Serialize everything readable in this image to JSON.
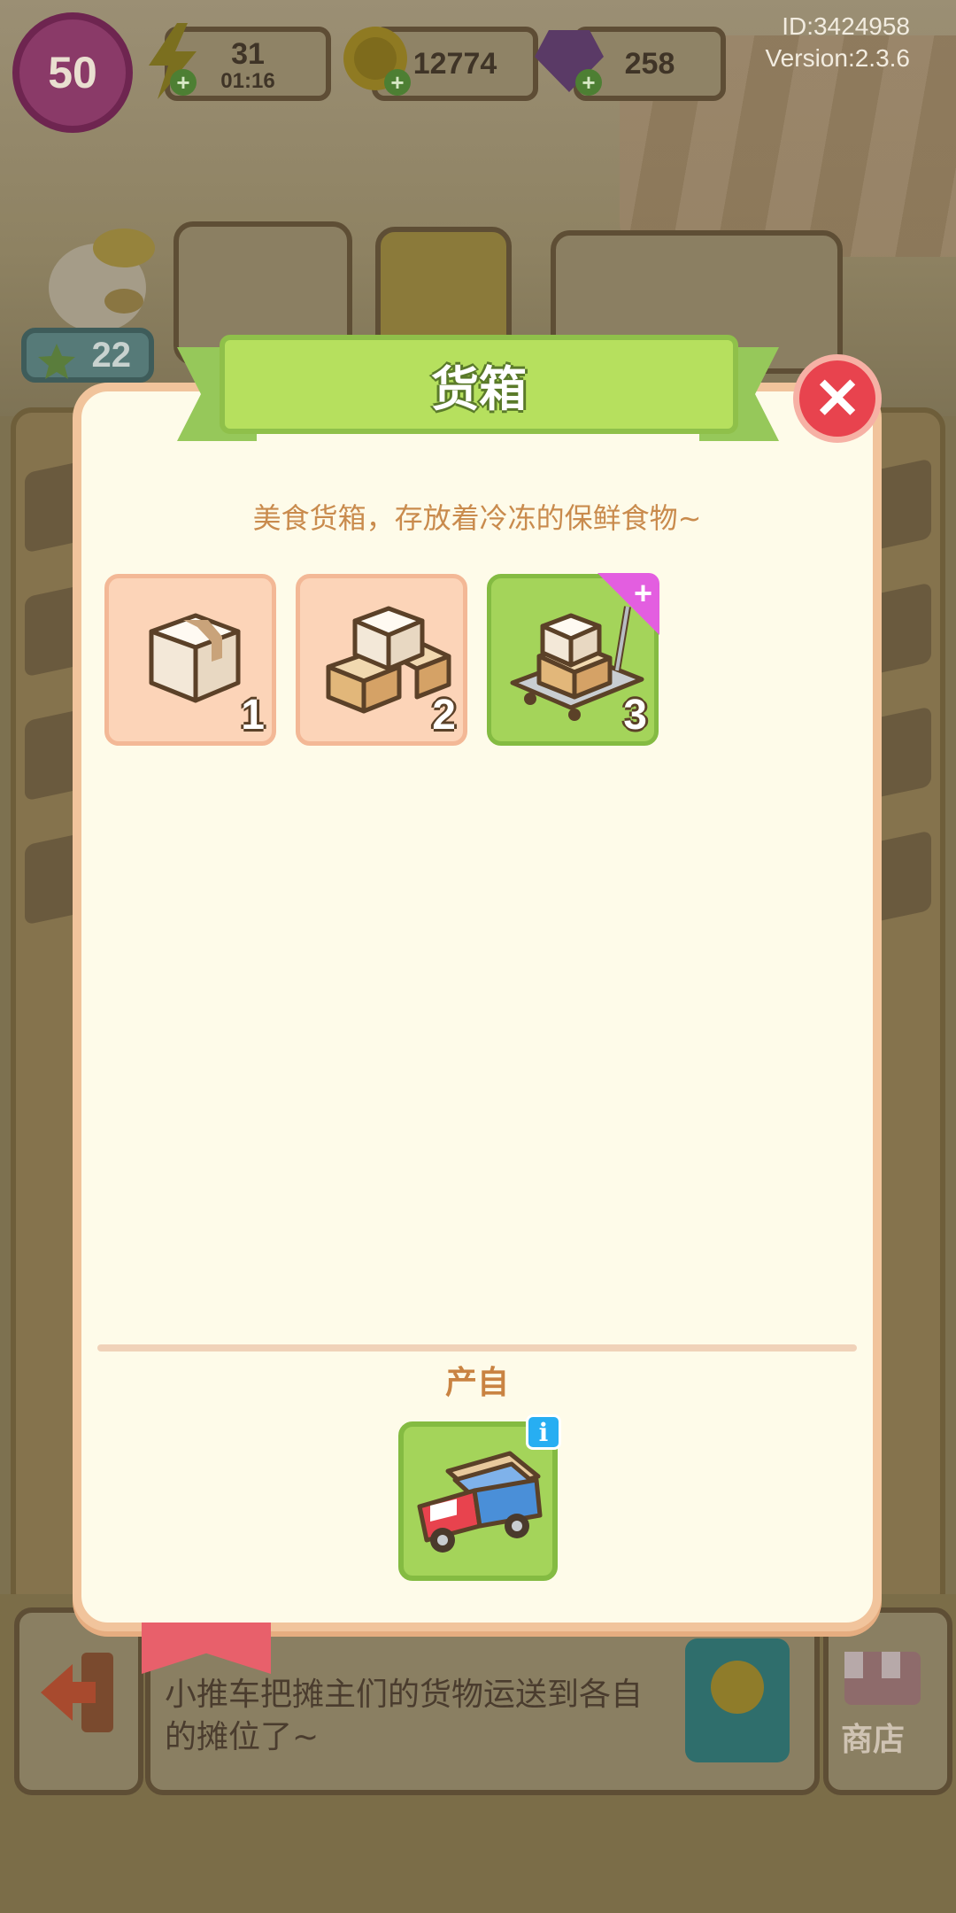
{
  "hud": {
    "level": "50",
    "energy": "31",
    "energy_timer": "01:16",
    "coins": "12774",
    "gems": "258",
    "player_id": "ID:3424958",
    "version": "Version:2.3.6",
    "stars": "22"
  },
  "dialog": {
    "title": "货箱",
    "description": "美食货箱，存放着冷冻的保鲜食物~",
    "items": [
      {
        "level": "1",
        "icon": "single-box-icon"
      },
      {
        "level": "2",
        "icon": "stacked-boxes-icon"
      },
      {
        "level": "3",
        "icon": "cart-with-boxes-icon"
      }
    ],
    "source_label": "产自",
    "source_icon": "delivery-truck-icon",
    "close_icon": "close-icon",
    "info_icon": "info-icon"
  },
  "background": {
    "bottom_message": "小推车把摊主们的货物运送到各自的摊位了~",
    "shop_label": "商店"
  },
  "colors": {
    "dialog_bg": "#fefbe9",
    "title_banner": "#b6e05e",
    "close_button": "#e8434e",
    "item_bg": "#fcd4b8",
    "item_selected": "#a4d45a",
    "description_text": "#c98b4d"
  }
}
